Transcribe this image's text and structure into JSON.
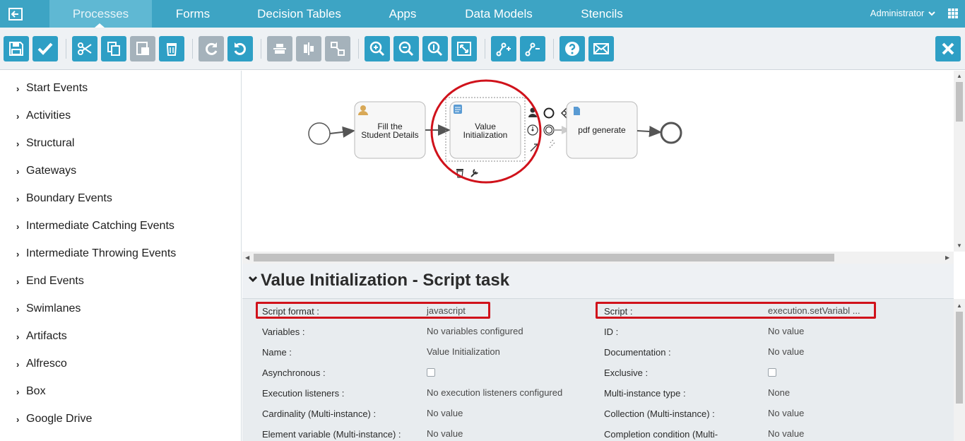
{
  "nav": {
    "tabs": [
      "Processes",
      "Forms",
      "Decision Tables",
      "Apps",
      "Data Models",
      "Stencils"
    ],
    "active_tab": "Processes",
    "user": "Administrator",
    "back_icon": "back-arrow-icon",
    "apps_icon": "grid-menu-icon"
  },
  "toolbar": {
    "buttons": [
      "save-icon",
      "validate-check-icon",
      "cut-icon",
      "copy-icon",
      "paste-icon",
      "delete-icon",
      "redo-icon",
      "undo-icon",
      "align-horizontal-icon",
      "align-vertical-icon",
      "same-size-icon",
      "zoom-in-icon",
      "zoom-out-icon",
      "zoom-actual-icon",
      "zoom-fit-icon",
      "add-bendpoint-icon",
      "remove-bendpoint-icon",
      "help-icon",
      "feedback-mail-icon",
      "close-icon"
    ]
  },
  "palette": {
    "items": [
      "Start Events",
      "Activities",
      "Structural",
      "Gateways",
      "Boundary Events",
      "Intermediate Catching Events",
      "Intermediate Throwing Events",
      "End Events",
      "Swimlanes",
      "Artifacts",
      "Alfresco",
      "Box",
      "Google Drive"
    ]
  },
  "diagram": {
    "task1": {
      "line1": "Fill the",
      "line2": "Student Details",
      "icon": "user-task-icon"
    },
    "task2": {
      "line1": "Value",
      "line2": "Initialization",
      "icon": "script-task-icon"
    },
    "task3": {
      "label": "pdf generate",
      "icon": "document-task-icon"
    }
  },
  "properties": {
    "title": "Value Initialization - Script task",
    "left": [
      {
        "label": "Script format :",
        "value": "javascript"
      },
      {
        "label": "Variables :",
        "value": "No variables configured"
      },
      {
        "label": "Name :",
        "value": "Value Initialization"
      },
      {
        "label": "Asynchronous :",
        "value": ""
      },
      {
        "label": "Execution listeners :",
        "value": "No execution listeners configured"
      },
      {
        "label": "Cardinality (Multi-instance) :",
        "value": "No value"
      },
      {
        "label": "Element variable (Multi-instance) :",
        "value": "No value"
      }
    ],
    "right": [
      {
        "label": "Script :",
        "value": "execution.setVariabl ..."
      },
      {
        "label": "ID :",
        "value": "No value"
      },
      {
        "label": "Documentation :",
        "value": "No value"
      },
      {
        "label": "Exclusive :",
        "value": ""
      },
      {
        "label": "Multi-instance type :",
        "value": "None"
      },
      {
        "label": "Collection (Multi-instance) :",
        "value": "No value"
      },
      {
        "label": "Completion condition (Multi-",
        "value": "No value"
      }
    ]
  },
  "colors": {
    "nav": "#3da4c4",
    "button": "#2e9fc5",
    "highlight": "#d0121b"
  }
}
